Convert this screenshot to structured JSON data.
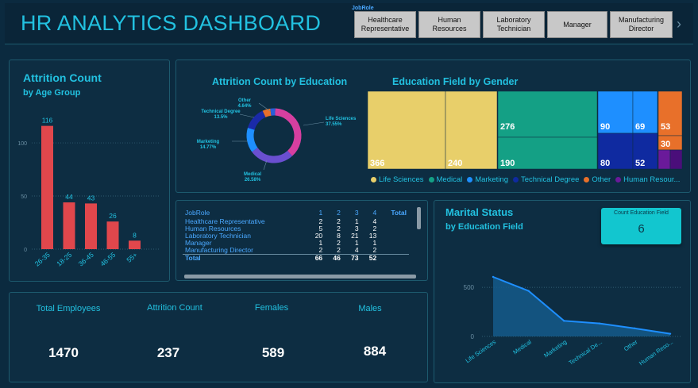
{
  "header": {
    "title": "HR ANALYTICS DASHBOARD",
    "slicer_label": "JobRole",
    "slicer_items": [
      "Healthcare Representative",
      "Human Resources",
      "Laboratory Technician",
      "Manager",
      "Manufacturing Director"
    ],
    "more_icon": "chevron-right-icon"
  },
  "attrition_age": {
    "title": "Attrition Count",
    "subtitle": "by Age Group"
  },
  "education_donut": {
    "title": "Attrition Count by Education"
  },
  "education_gender": {
    "title": "Education Field by Gender"
  },
  "matrix": {
    "headers": [
      "JobRole",
      "1",
      "2",
      "3",
      "4",
      "Total"
    ],
    "rows": [
      {
        "role": "Healthcare Representative",
        "c1": "2",
        "c2": "2",
        "c3": "1",
        "c4": "4"
      },
      {
        "role": "Human Resources",
        "c1": "5",
        "c2": "2",
        "c3": "3",
        "c4": "2"
      },
      {
        "role": "Laboratory Technician",
        "c1": "20",
        "c2": "8",
        "c3": "21",
        "c4": "13"
      },
      {
        "role": "Manager",
        "c1": "1",
        "c2": "2",
        "c3": "1",
        "c4": "1"
      },
      {
        "role": "Manufacturing Director",
        "c1": "2",
        "c2": "2",
        "c3": "4",
        "c4": "2"
      }
    ],
    "total": {
      "role": "Total",
      "c1": "66",
      "c2": "46",
      "c3": "73",
      "c4": "52"
    }
  },
  "kpis": {
    "total_employees_label": "Total Employees",
    "total_employees_value": "1470",
    "attrition_label": "Attrition Count",
    "attrition_value": "237",
    "females_label": "Females",
    "females_value": "589",
    "males_label": "Males",
    "males_value": "884"
  },
  "marital": {
    "title": "Marital Status",
    "subtitle": "by Education Field",
    "card_label": "Count Education Field",
    "card_value": "6"
  },
  "colors": {
    "accent": "#22c1e0",
    "bar_red": "#e0474c",
    "life_sciences": "#e8cf6a",
    "medical": "#14a085",
    "marketing": "#1e8fff",
    "technical": "#0f2aa0",
    "other": "#e8702a",
    "human_resources": "#6a1a9a"
  },
  "chart_data": [
    {
      "type": "bar",
      "title": "Attrition Count",
      "subtitle": "by Age Group",
      "categories": [
        "26-35",
        "18-25",
        "36-45",
        "46-55",
        "55+"
      ],
      "values": [
        116,
        44,
        43,
        26,
        8
      ],
      "ytick_values": [
        0,
        50,
        100
      ],
      "ytick_labels": [
        "0",
        "50",
        "100"
      ],
      "ylim": [
        0,
        130
      ]
    },
    {
      "type": "pie",
      "title": "Attrition Count by Education",
      "slices": [
        {
          "name": "Life Sciences",
          "label": "Life Sciences 37.55%",
          "value": 37.55,
          "color": "#d63fa0"
        },
        {
          "name": "Medical",
          "label": "Medical 26.58%",
          "value": 26.58,
          "color": "#6a4fd0"
        },
        {
          "name": "Marketing",
          "label": "Marketing 14.77%",
          "value": 14.77,
          "color": "#1e8fff"
        },
        {
          "name": "Technical Degree",
          "label": "Technical Degree 13.5%",
          "value": 13.5,
          "color": "#1a2aa8"
        },
        {
          "name": "Other",
          "label": "Other 4.64%",
          "value": 4.64,
          "color": "#e8702a"
        },
        {
          "name": "Human Resources",
          "label": "",
          "value": 2.96,
          "color": "#2a5fd8"
        }
      ]
    },
    {
      "type": "heatmap",
      "title": "Education Field by Gender",
      "cells": [
        {
          "field": "Life Sciences",
          "values": [
            366,
            240
          ],
          "color": "#e8cf6a"
        },
        {
          "field": "Medical",
          "values": [
            276,
            190
          ],
          "color": "#14a085"
        },
        {
          "field": "Marketing",
          "values": [
            90,
            69
          ],
          "color": "#1e8fff"
        },
        {
          "field": "Technical Degree",
          "values": [
            80,
            52
          ],
          "color": "#0f2aa0"
        },
        {
          "field": "Other",
          "values": [
            53,
            30
          ],
          "color": "#e8702a"
        },
        {
          "field": "Human Resources",
          "values": [
            0,
            0
          ],
          "color": "#6a1a9a"
        }
      ],
      "legend": [
        "Life Sciences",
        "Medical",
        "Marketing",
        "Technical Degree",
        "Other",
        "Human Resour..."
      ]
    },
    {
      "type": "area",
      "title": "Marital Status",
      "subtitle": "by Education Field",
      "categories": [
        "Life Sciences",
        "Medical",
        "Marketing",
        "Technical De...",
        "Other",
        "Human Reso..."
      ],
      "values": [
        606,
        464,
        159,
        132,
        82,
        27
      ],
      "ytick_values": [
        0,
        500
      ],
      "ytick_labels": [
        "0",
        "500"
      ],
      "ylim": [
        0,
        650
      ]
    }
  ]
}
